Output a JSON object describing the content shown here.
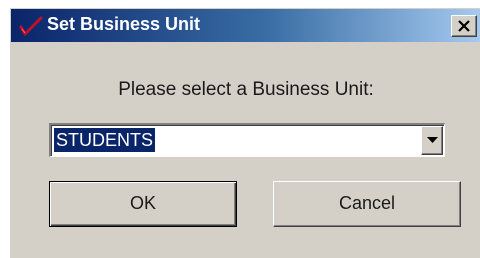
{
  "window": {
    "title": "Set Business Unit",
    "app_icon": "red-checkmark-icon",
    "close_icon": "close-x-icon"
  },
  "form": {
    "prompt": "Please select a Business Unit:",
    "business_unit_selected": "STUDENTS",
    "dropdown_icon": "chevron-down-icon"
  },
  "buttons": {
    "ok_label": "OK",
    "cancel_label": "Cancel"
  },
  "colors": {
    "titlebar_start": "#0a246a",
    "titlebar_end": "#a6caf0",
    "dialog_face": "#d4d0c8",
    "selection": "#0a246a"
  }
}
